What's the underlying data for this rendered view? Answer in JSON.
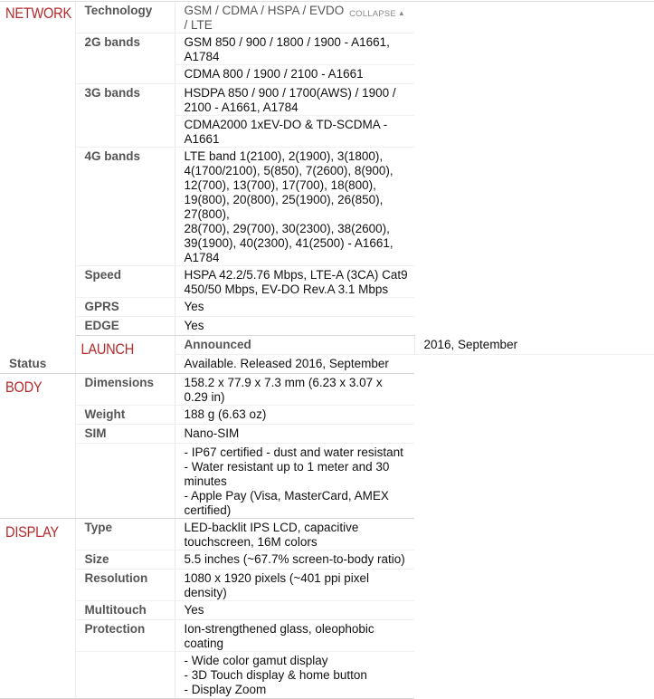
{
  "collapse_label": "COLLAPSE",
  "accent_color": "#b52a2a",
  "sections": {
    "network": {
      "title": "NETWORK",
      "technology": {
        "label": "Technology",
        "value": "GSM / CDMA / HSPA / EVDO / LTE"
      },
      "bands_2g": {
        "label": "2G bands",
        "values": [
          "GSM 850 / 900 / 1800 / 1900 - A1661, A1784",
          "CDMA 800 / 1900 / 2100 - A1661"
        ]
      },
      "bands_3g": {
        "label": "3G bands",
        "values": [
          "HSDPA 850 / 900 / 1700(AWS) / 1900 / 2100 - A1661, A1784",
          "CDMA2000 1xEV-DO & TD-SCDMA - A1661"
        ]
      },
      "bands_4g": {
        "label": "4G bands",
        "lines": [
          "LTE band 1(2100), 2(1900), 3(1800), 4(1700/2100), 5(850), 7(2600), 8(900),",
          "12(700), 13(700), 17(700), 18(800), 19(800), 20(800), 25(1900), 26(850), 27(800),",
          "28(700), 29(700), 30(2300), 38(2600), 39(1900), 40(2300), 41(2500) - A1661,",
          "A1784"
        ]
      },
      "speed": {
        "label": "Speed",
        "value": "HSPA 42.2/5.76 Mbps, LTE-A (3CA) Cat9 450/50 Mbps, EV-DO Rev.A 3.1 Mbps"
      },
      "gprs": {
        "label": "GPRS",
        "value": "Yes"
      },
      "edge": {
        "label": "EDGE",
        "value": "Yes"
      }
    },
    "launch": {
      "title": "LAUNCH",
      "announced": {
        "label": "Announced",
        "value": "2016, September"
      },
      "status": {
        "label": "Status",
        "value": "Available. Released 2016, September"
      }
    },
    "body": {
      "title": "BODY",
      "dimensions": {
        "label": "Dimensions",
        "value": "158.2 x 77.9 x 7.3 mm (6.23 x 3.07 x 0.29 in)"
      },
      "weight": {
        "label": "Weight",
        "value": "188 g (6.63 oz)"
      },
      "sim": {
        "label": "SIM",
        "value": "Nano-SIM"
      },
      "extra": {
        "lines": [
          "- IP67 certified - dust and water resistant",
          "- Water resistant up to 1 meter and 30 minutes",
          "- Apple Pay (Visa, MasterCard, AMEX certified)"
        ]
      }
    },
    "display": {
      "title": "DISPLAY",
      "type": {
        "label": "Type",
        "value": "LED-backlit IPS LCD, capacitive touchscreen, 16M colors"
      },
      "size": {
        "label": "Size",
        "value": "5.5 inches (~67.7% screen-to-body ratio)"
      },
      "resolution": {
        "label": "Resolution",
        "value": "1080 x 1920 pixels (~401 ppi pixel density)"
      },
      "multitouch": {
        "label": "Multitouch",
        "value": "Yes"
      },
      "protection": {
        "label": "Protection",
        "value": "Ion-strengthened glass, oleophobic coating"
      },
      "extra": {
        "lines": [
          "- Wide color gamut display",
          "- 3D Touch display & home button",
          "- Display Zoom"
        ]
      }
    }
  }
}
